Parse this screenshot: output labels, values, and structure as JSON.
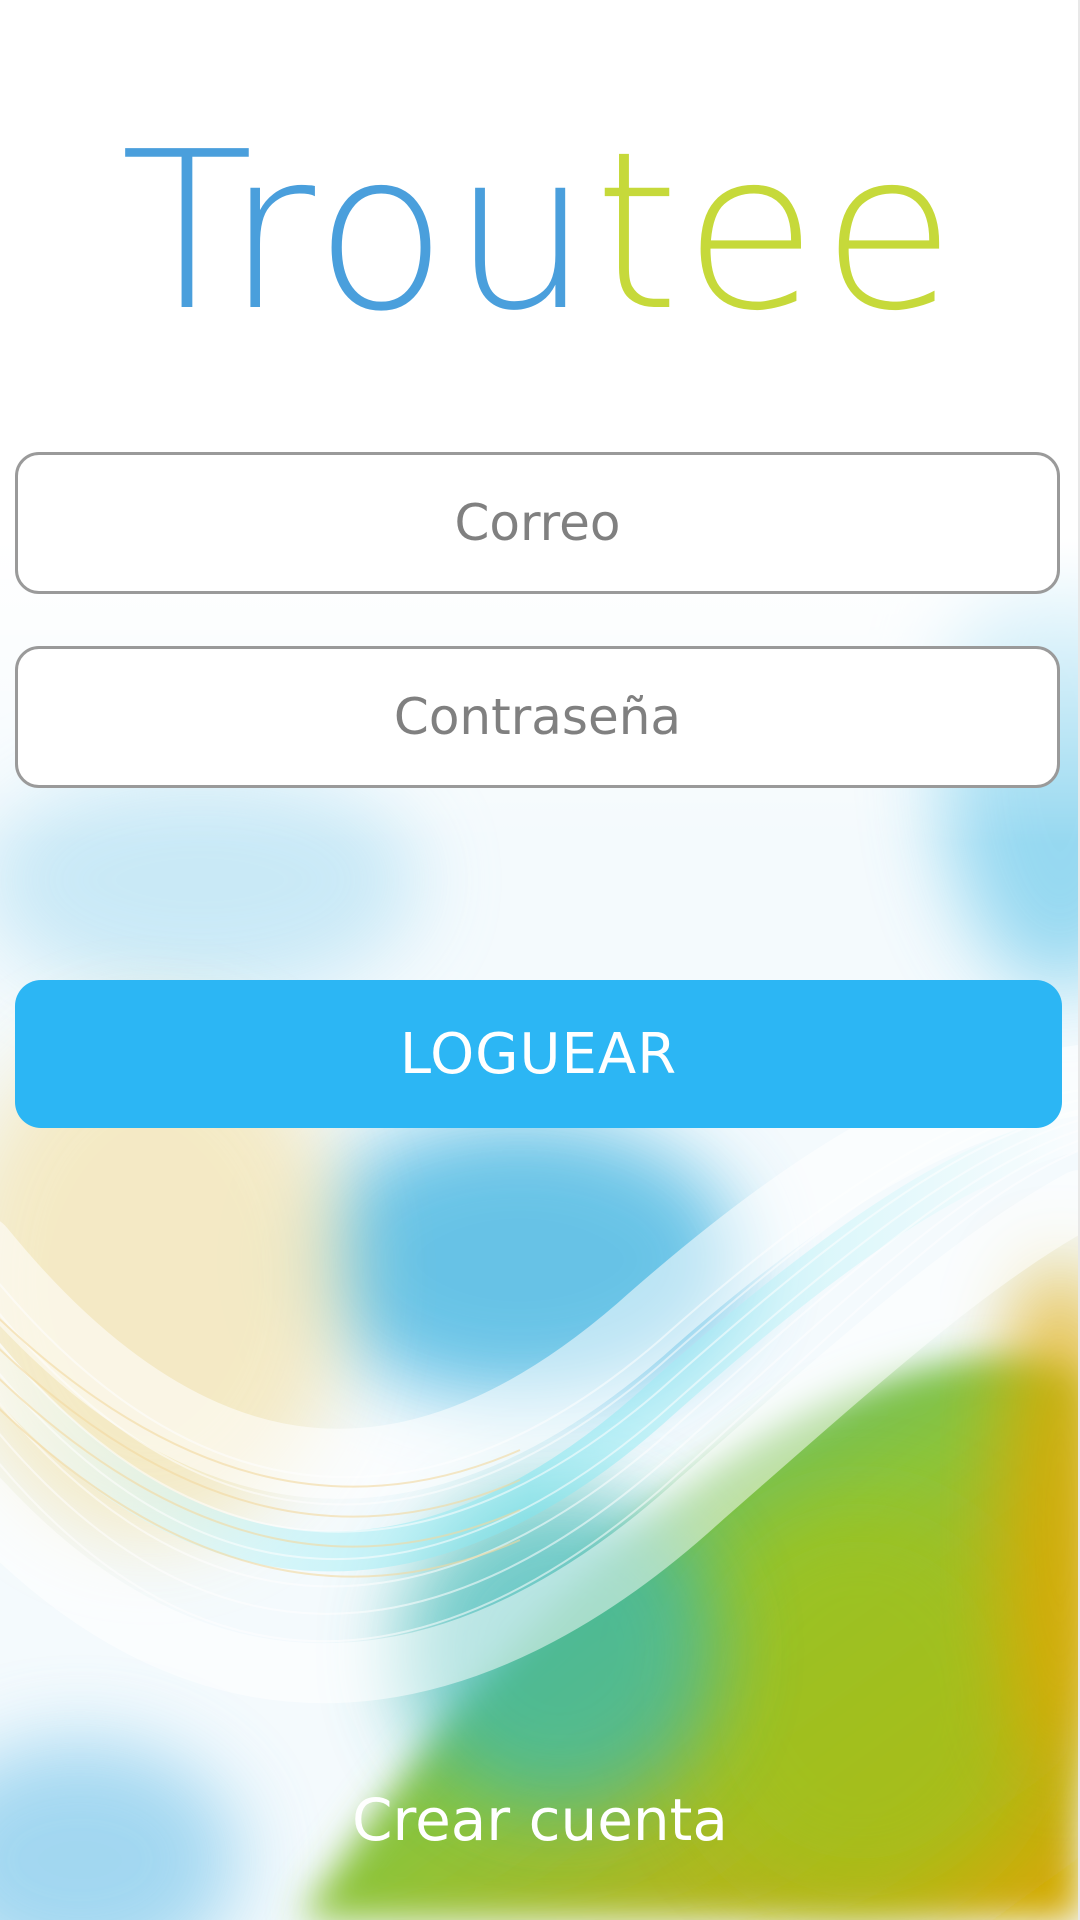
{
  "app": {
    "logo_part_blue": "Trou",
    "logo_part_green": "tee"
  },
  "form": {
    "email_placeholder": "Correo",
    "email_value": "",
    "password_placeholder": "Contraseña",
    "password_value": "",
    "login_label": "LOGUEAR",
    "create_account_label": "Crear cuenta"
  },
  "colors": {
    "brand_blue": "#4a9fdc",
    "brand_green": "#c6d93a",
    "button": "#2cb6f4",
    "field_border": "#9a9a9a"
  }
}
